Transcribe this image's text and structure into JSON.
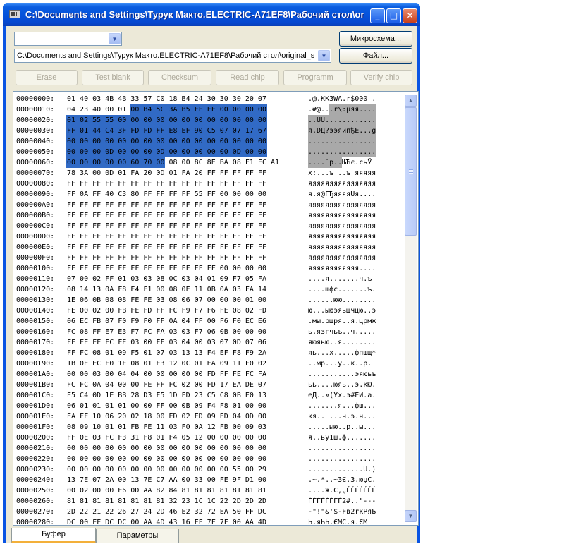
{
  "window": {
    "title": "C:\\Documents and Settings\\Турук Макто.ELECTRIC-A71EF8\\Рабочий стол\\or...",
    "buttons": {
      "minimize": "_",
      "maximize": "□",
      "close": "✕"
    }
  },
  "device_select": {
    "value": ""
  },
  "file_path_select": {
    "value": "C:\\Documents and Settings\\Турук Макто.ELECTRIC-A71EF8\\Рабочий стол\\original_s"
  },
  "buttons": {
    "chip": "Микросхема...",
    "file": "Файл...",
    "erase": "Erase",
    "test_blank": "Test blank",
    "checksum": "Checksum",
    "read_chip": "Read chip",
    "program": "Programm",
    "verify_chip": "Verify chip"
  },
  "hex_view": {
    "selection_start": 21,
    "selection_end": 103,
    "rows": [
      {
        "addr": "00000000:",
        "hex": "01 40 03 4B 4B 33 57 C0 18 B4 24 30 30 30 20 07",
        "ascii": ".@.KK3WA.r$000 ."
      },
      {
        "addr": "00000010:",
        "hex": "04 23 40 00 01 00 B4 5C 3A B5 FF FF 00 00 00 00",
        "ascii": ".#@...r\\:µяя...."
      },
      {
        "addr": "00000020:",
        "hex": "01 02 55 55 00 00 00 00 00 00 00 00 00 00 00 00",
        "ascii": "..UU............"
      },
      {
        "addr": "00000030:",
        "hex": "FF 01 44 C4 3F FD FD FF E8 EF 90 C5 07 07 17 67",
        "ascii": "я.DД?ээяипђЕ...g"
      },
      {
        "addr": "00000040:",
        "hex": "00 00 00 00 00 00 00 00 00 00 00 00 00 00 00 00",
        "ascii": "................"
      },
      {
        "addr": "00000050:",
        "hex": "00 00 00 0D 00 00 00 0D 00 00 00 00 00 0D 00 00",
        "ascii": "................"
      },
      {
        "addr": "00000060:",
        "hex": "00 00 00 00 00 60 70 00 08 00 8C 8E BA 08 F1 FC A1",
        "ascii": "....`p..ЊЋє.сьЎ"
      },
      {
        "addr": "00000070:",
        "hex": "78 3A 00 0D 01 FA 20 0D 01 FA 20 FF FF FF FF FF",
        "ascii": "x:...ъ ..ъ яяяяя"
      },
      {
        "addr": "00000080:",
        "hex": "FF FF FF FF FF FF FF FF FF FF FF FF FF FF FF FF",
        "ascii": "яяяяяяяяяяяяяяяя"
      },
      {
        "addr": "00000090:",
        "hex": "FF 0A FF 40 C3 80 FF FF FF FF 55 FF 00 00 00 00",
        "ascii": "я.я@ГЂяяяяUя...."
      },
      {
        "addr": "000000A0:",
        "hex": "FF FF FF FF FF FF FF FF FF FF FF FF FF FF FF FF",
        "ascii": "яяяяяяяяяяяяяяяя"
      },
      {
        "addr": "000000B0:",
        "hex": "FF FF FF FF FF FF FF FF FF FF FF FF FF FF FF FF",
        "ascii": "яяяяяяяяяяяяяяяя"
      },
      {
        "addr": "000000C0:",
        "hex": "FF FF FF FF FF FF FF FF FF FF FF FF FF FF FF FF",
        "ascii": "яяяяяяяяяяяяяяяя"
      },
      {
        "addr": "000000D0:",
        "hex": "FF FF FF FF FF FF FF FF FF FF FF FF FF FF FF FF",
        "ascii": "яяяяяяяяяяяяяяяя"
      },
      {
        "addr": "000000E0:",
        "hex": "FF FF FF FF FF FF FF FF FF FF FF FF FF FF FF FF",
        "ascii": "яяяяяяяяяяяяяяяя"
      },
      {
        "addr": "000000F0:",
        "hex": "FF FF FF FF FF FF FF FF FF FF FF FF FF FF FF FF",
        "ascii": "яяяяяяяяяяяяяяяя"
      },
      {
        "addr": "00000100:",
        "hex": "FF FF FF FF FF FF FF FF FF FF FF FF 00 00 00 00",
        "ascii": "яяяяяяяяяяяя...."
      },
      {
        "addr": "00000110:",
        "hex": "07 00 02 FF 01 03 03 08 0C 03 04 01 09 F7 05 FA",
        "ascii": "....я.......ч.ъ"
      },
      {
        "addr": "00000120:",
        "hex": "08 14 13 0A F8 F4 F1 00 08 0E 11 0B 0A 03 FA 14",
        "ascii": "....шфс.......ъ."
      },
      {
        "addr": "00000130:",
        "hex": "1E 06 0B 08 08 FE FE 03 08 06 07 00 00 00 01 00",
        "ascii": "......юю........"
      },
      {
        "addr": "00000140:",
        "hex": "FE 00 02 00 FB FE FD FF FC F9 F7 F6 FE 08 02 FD",
        "ascii": "ю...ыюэяьщчцю..э"
      },
      {
        "addr": "00000150:",
        "hex": "06 EC FB 07 F0 F9 F0 FF 0A 04 FF 00 F6 F0 EC E6",
        "ascii": ".мы.рщря..я.црмж"
      },
      {
        "addr": "00000160:",
        "hex": "FC 08 FF E7 E3 F7 FC FA 03 03 F7 06 0B 00 00 00",
        "ascii": "ь.язгчьъ..ч....."
      },
      {
        "addr": "00000170:",
        "hex": "FF FE FF FC FE 03 00 FF 03 04 00 03 07 0D 07 06",
        "ascii": "яюяью..я........"
      },
      {
        "addr": "00000180:",
        "hex": "FF FC 08 01 09 F5 01 07 03 13 13 F4 EF F8 F9 2A",
        "ascii": "яь...х.....фпшщ*"
      },
      {
        "addr": "00000190:",
        "hex": "1B 0E EC F0 1F 08 01 F3 12 0C 01 EA 09 11 F0 02",
        "ascii": "..мр...у..к..р."
      },
      {
        "addr": "000001A0:",
        "hex": "00 00 03 00 04 04 00 00 00 00 00 FD FF FE FC FA",
        "ascii": "...........эяюьъ"
      },
      {
        "addr": "000001B0:",
        "hex": "FC FC 0A 04 00 00 FE FF FC 02 00 FD 17 EA DE 07",
        "ascii": "ьь....юяь..э.кЮ."
      },
      {
        "addr": "000001C0:",
        "hex": "E5 C4 0D 1E BB 28 D3 F5 1D FD 23 C5 C8 0B E0 13",
        "ascii": "еД..»(Ух.э#ЕИ.а."
      },
      {
        "addr": "000001D0:",
        "hex": "06 01 01 01 01 00 00 FF 00 0B 09 F4 F8 01 00 00",
        "ascii": ".......я...фш..."
      },
      {
        "addr": "000001E0:",
        "hex": "EA FF 10 06 20 02 18 00 ED 02 FD 09 ED 04 0D 00",
        "ascii": "кя.. ...н.э.н..."
      },
      {
        "addr": "000001F0:",
        "hex": "08 09 10 01 01 FB FE 11 03 F0 0A 12 FB 00 09 03",
        "ascii": ".....ыю..р..ы..."
      },
      {
        "addr": "00000200:",
        "hex": "FF 0E 03 FC F3 31 F8 01 F4 05 12 00 00 00 00 00",
        "ascii": "я..ьу1ш.ф......."
      },
      {
        "addr": "00000210:",
        "hex": "00 00 00 00 00 00 00 00 00 00 00 00 00 00 00 00",
        "ascii": "................"
      },
      {
        "addr": "00000220:",
        "hex": "00 00 00 00 00 00 00 00 00 00 00 00 00 00 00 00",
        "ascii": "................"
      },
      {
        "addr": "00000230:",
        "hex": "00 00 00 00 00 00 00 00 00 00 00 00 00 55 00 29",
        "ascii": ".............U.)"
      },
      {
        "addr": "00000240:",
        "hex": "13 7E 07 2A 00 13 7E C7 AA 00 33 00 FE 9F D1 00",
        "ascii": ".~.*..~ЗЄ.3.юџС."
      },
      {
        "addr": "00000250:",
        "hex": "00 02 00 00 E6 0D AA 82 84 81 81 81 81 81 81 81",
        "ascii": "....ж.Є‚„ЃЃЃЃЃЃЃ"
      },
      {
        "addr": "00000260:",
        "hex": "81 81 81 81 81 81 81 81 32 23 1C 1C 22 2D 2D 2D",
        "ascii": "ЃЃЃЃЃЃЃЃ2#..\"---"
      },
      {
        "addr": "00000270:",
        "hex": "2D 22 21 22 26 27 24 2D 46 E2 32 72 EA 50 FF DC",
        "ascii": "-\"!\"&'$-Fв2rкPяЬ"
      },
      {
        "addr": "00000280:",
        "hex": "DC 00 FF DC DC 00 AA 4D 43 16 FF 7F 7F 00 AA 4D",
        "ascii": "Ь.яЬЬ.ЄMC.я.ЄМ"
      }
    ]
  },
  "tabs": {
    "buffer": "Буфер",
    "params": "Параметры"
  }
}
